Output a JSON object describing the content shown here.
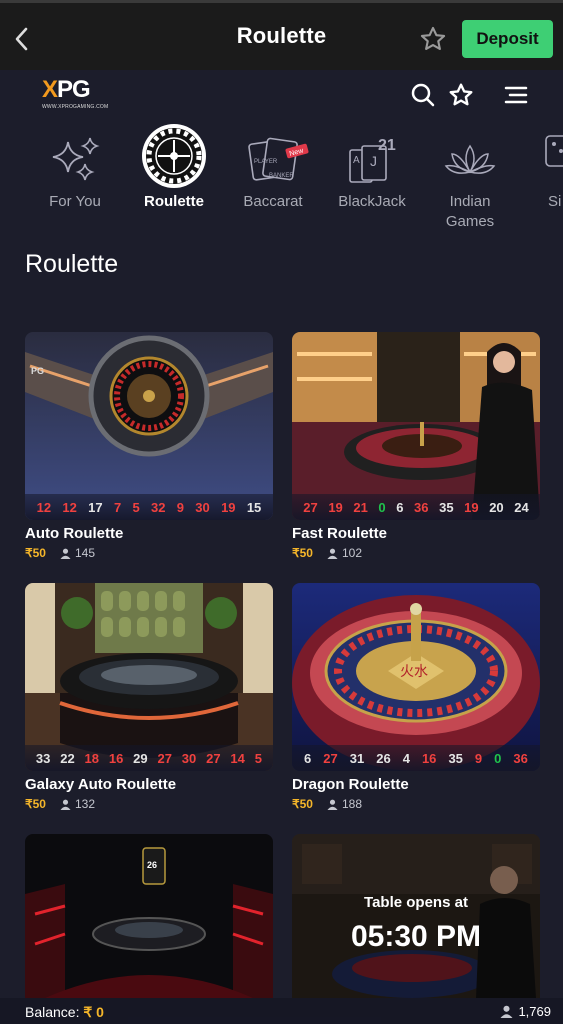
{
  "topbar": {
    "title": "Roulette",
    "deposit_label": "Deposit"
  },
  "brand": {
    "logo_main": "PG",
    "logo_x": "X",
    "logo_sub": "WWW.XPROGAMING.COM"
  },
  "categories": [
    {
      "label": "For You",
      "icon": "sparkles-icon"
    },
    {
      "label": "Roulette",
      "icon": "roulette-wheel-icon",
      "active": true
    },
    {
      "label": "Baccarat",
      "icon": "baccarat-cards-icon",
      "badge": "New"
    },
    {
      "label": "BlackJack",
      "icon": "blackjack-cards-icon",
      "badge": "21"
    },
    {
      "label": "Indian\nGames",
      "icon": "lotus-icon"
    },
    {
      "label": "Si",
      "icon": "dice-icon"
    }
  ],
  "section_title": "Roulette",
  "games": [
    {
      "name": "Auto Roulette",
      "bet": "₹50",
      "players": "145",
      "results": [
        [
          "12",
          "red"
        ],
        [
          "12",
          "red"
        ],
        [
          "17",
          "black"
        ],
        [
          "7",
          "red"
        ],
        [
          "5",
          "red"
        ],
        [
          "32",
          "red"
        ],
        [
          "9",
          "red"
        ],
        [
          "30",
          "red"
        ],
        [
          "19",
          "red"
        ],
        [
          "15",
          "black"
        ]
      ]
    },
    {
      "name": "Fast Roulette",
      "bet": "₹50",
      "players": "102",
      "results": [
        [
          "27",
          "red"
        ],
        [
          "19",
          "red"
        ],
        [
          "21",
          "red"
        ],
        [
          "0",
          "green"
        ],
        [
          "6",
          "black"
        ],
        [
          "36",
          "red"
        ],
        [
          "35",
          "black"
        ],
        [
          "19",
          "red"
        ],
        [
          "20",
          "black"
        ],
        [
          "24",
          "black"
        ]
      ]
    },
    {
      "name": "Galaxy Auto Roulette",
      "bet": "₹50",
      "players": "132",
      "results": [
        [
          "33",
          "black"
        ],
        [
          "22",
          "black"
        ],
        [
          "18",
          "red"
        ],
        [
          "16",
          "red"
        ],
        [
          "29",
          "black"
        ],
        [
          "27",
          "red"
        ],
        [
          "30",
          "red"
        ],
        [
          "27",
          "red"
        ],
        [
          "14",
          "red"
        ],
        [
          "5",
          "red"
        ]
      ]
    },
    {
      "name": "Dragon Roulette",
      "bet": "₹50",
      "players": "188",
      "results": [
        [
          "6",
          "black"
        ],
        [
          "27",
          "red"
        ],
        [
          "31",
          "black"
        ],
        [
          "26",
          "black"
        ],
        [
          "4",
          "black"
        ],
        [
          "16",
          "red"
        ],
        [
          "35",
          "black"
        ],
        [
          "9",
          "red"
        ],
        [
          "0",
          "green"
        ],
        [
          "36",
          "red"
        ]
      ]
    }
  ],
  "closed_table": {
    "text": "Table opens at",
    "time": "05:30 PM",
    "card_badge": "26"
  },
  "footer": {
    "balance_label": "Balance:",
    "balance_value": "₹ 0",
    "online_count": "1,769"
  },
  "colors": {
    "accent_green": "#3ecf74",
    "gold": "#f5b62a",
    "red": "#f0413f",
    "bg": "#1c1d2b"
  }
}
